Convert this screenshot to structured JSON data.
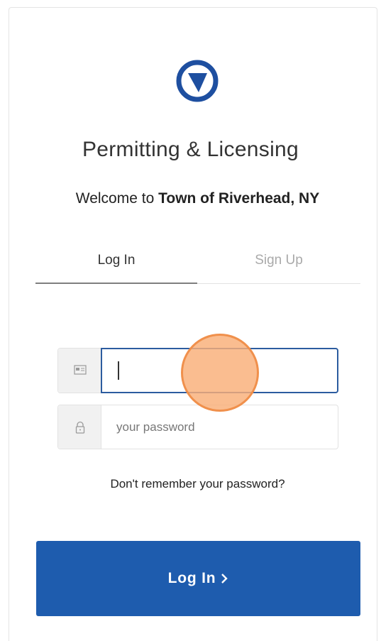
{
  "header": {
    "logo_icon": "location-arrow-circle-icon",
    "title": "Permitting & Licensing",
    "welcome_prefix": "Welcome to ",
    "welcome_org": "Town of Riverhead, NY"
  },
  "tabs": [
    {
      "label": "Log In",
      "active": true
    },
    {
      "label": "Sign Up",
      "active": false
    }
  ],
  "form": {
    "user_icon": "id-card-icon",
    "user_value": "",
    "password_icon": "lock-icon",
    "password_placeholder": "your password",
    "forgot_link": "Don't remember your password?",
    "submit_label": "Log In",
    "submit_icon": "chevron-right-icon"
  },
  "colors": {
    "brand_blue": "#1e5cae",
    "focus_border": "#2c5c9f",
    "touch_indicator": "#f9af78"
  }
}
